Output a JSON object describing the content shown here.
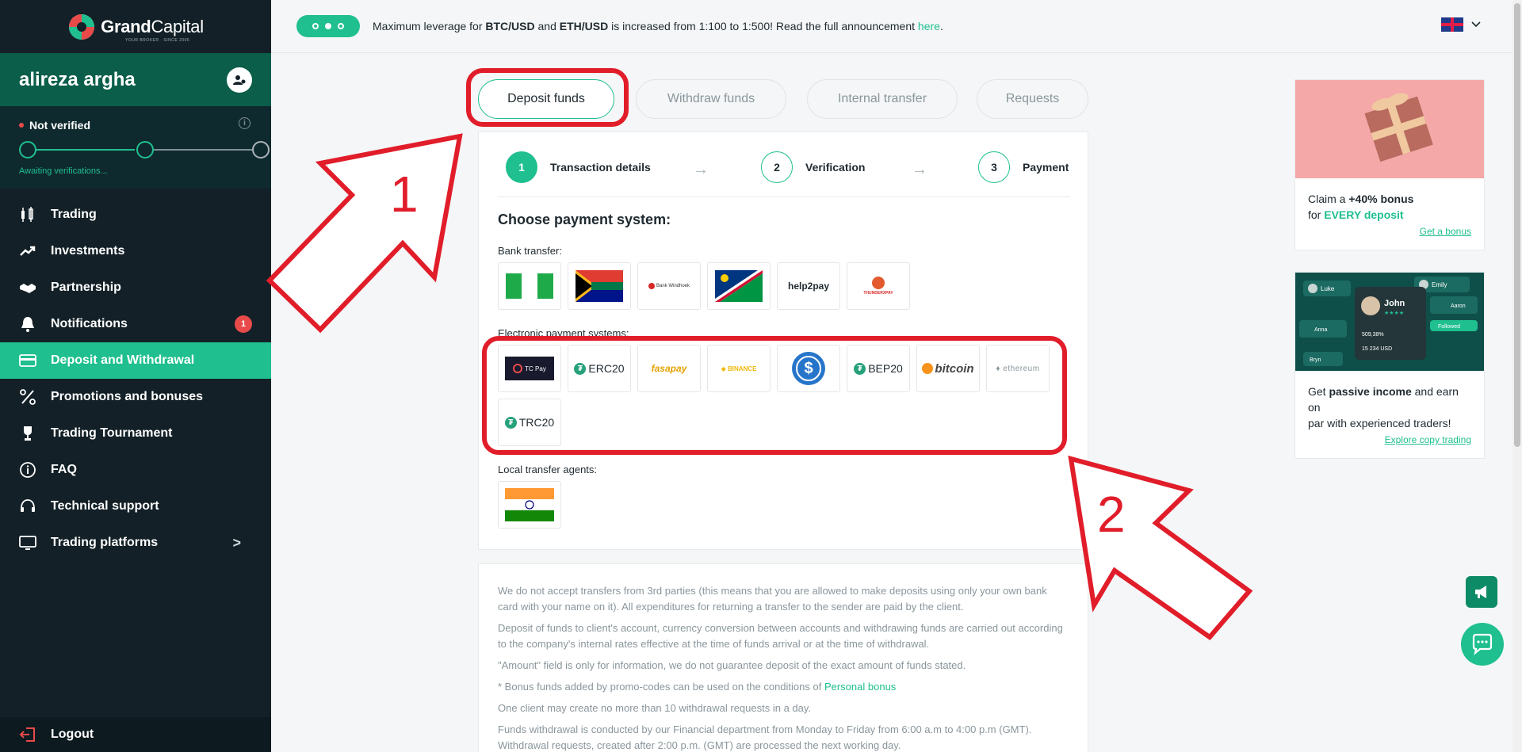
{
  "brand": {
    "name_part1": "Grand",
    "name_part2": "Capital",
    "tagline": "YOUR BROKER · SINCE 2006"
  },
  "user": {
    "name": "alireza argha"
  },
  "verification": {
    "status": "Not verified",
    "info_glyph": "i",
    "awaiting": "Awaiting verifications..."
  },
  "nav": [
    {
      "label": "Trading",
      "icon": "candlestick-icon"
    },
    {
      "label": "Investments",
      "icon": "trend-up-icon"
    },
    {
      "label": "Partnership",
      "icon": "handshake-icon"
    },
    {
      "label": "Notifications",
      "icon": "bell-icon",
      "badge": "1"
    },
    {
      "label": "Deposit and Withdrawal",
      "icon": "card-icon",
      "active": true
    },
    {
      "label": "Promotions and bonuses",
      "icon": "percent-icon"
    },
    {
      "label": "Trading Tournament",
      "icon": "trophy-icon"
    },
    {
      "label": "FAQ",
      "icon": "info-icon"
    },
    {
      "label": "Technical support",
      "icon": "headset-icon"
    },
    {
      "label": "Trading platforms",
      "icon": "monitor-icon",
      "chevron": ">"
    }
  ],
  "logout": "Logout",
  "announcement": {
    "pre": "Maximum leverage for ",
    "b1": "BTC/USD",
    "mid": " and ",
    "b2": "ETH/USD",
    "post": " is increased from 1:100 to 1:500! Read the full announcement ",
    "link": "here",
    "end": "."
  },
  "tabs": [
    "Deposit funds",
    "Withdraw funds",
    "Internal transfer",
    "Requests"
  ],
  "steps": [
    {
      "num": "1",
      "label": "Transaction details"
    },
    {
      "num": "2",
      "label": "Verification"
    },
    {
      "num": "3",
      "label": "Payment"
    }
  ],
  "step_arrow": "→",
  "choose_title": "Choose payment system:",
  "groups": {
    "bank": "Bank transfer:",
    "electronic": "Electronic payment systems:",
    "local": "Local transfer agents:"
  },
  "bank_tiles": [
    "",
    "",
    "Bank Windhoek",
    "",
    "help2pay",
    "THUNDERXPAY"
  ],
  "electronic_tiles": [
    "TC Pay",
    "ERC20",
    "fasapay",
    "BINANCE",
    "$",
    "BEP20",
    "bitcoin",
    "ethereum",
    "TRC20"
  ],
  "tether_glyph": "₮",
  "info_paragraphs": [
    "We do not accept transfers from 3rd parties (this means that you are allowed to make deposits using only your own bank card with your name on it). All expenditures for returning a transfer to the sender are paid by the client.",
    "Deposit of funds to client's account, currency conversion between accounts and withdrawing funds are carried out according to the company's internal rates effective at the time of funds arrival or at the time of withdrawal.",
    "\"Amount\" field is only for information, we do not guarantee deposit of the exact amount of funds stated.",
    "One client may create no more than 10 withdrawal requests in a day.",
    "Funds withdrawal is conducted by our Financial department from Monday to Friday from 6:00 a.m to 4:00 p.m (GMT). Withdrawal requests, created after 2:00 p.m. (GMT) are processed the next working day."
  ],
  "bonus_note": {
    "pre": "* Bonus funds added by promo-codes can be used on the conditions of ",
    "link": "Personal bonus"
  },
  "promos": [
    {
      "line1_pre": "Claim a ",
      "line1_b": "+40% bonus",
      "line2_pre": "for ",
      "line2_green": "EVERY deposit",
      "link": "Get a bonus"
    },
    {
      "line1_pre": "Get ",
      "line1_b": "passive income",
      "line1_post": " and earn on",
      "line2_pre": "par with experienced traders!",
      "link": "Explore copy trading",
      "pic_names": [
        "Luke",
        "Emily",
        "John",
        "Aaron",
        "Anna",
        "Bryn"
      ],
      "pic_stat1": "509,38%",
      "pic_stat2": "15 234 USD",
      "pic_stars": "★★★★",
      "pic_tag": "Followed"
    }
  ],
  "annotations": [
    "1",
    "2"
  ],
  "colors": {
    "accent": "#1fbf8f",
    "sidebar": "#132027",
    "annotation_red": "#e11d2a"
  }
}
